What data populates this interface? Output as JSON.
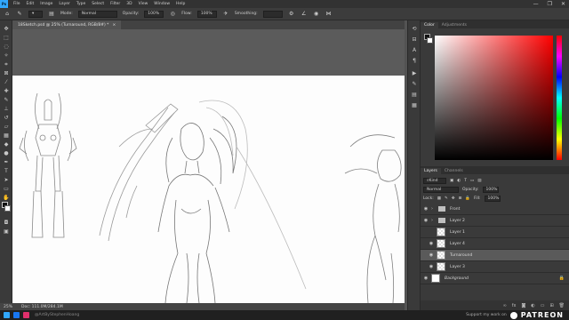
{
  "app": {
    "logo": "Ps"
  },
  "menu": [
    "File",
    "Edit",
    "Image",
    "Layer",
    "Type",
    "Select",
    "Filter",
    "3D",
    "View",
    "Window",
    "Help"
  ],
  "window_controls": [
    "—",
    "❐",
    "✕"
  ],
  "options_bar": {
    "mode_label": "Mode:",
    "mode_value": "Normal",
    "opacity_label": "Opacity:",
    "opacity_value": "100%",
    "flow_label": "Flow:",
    "flow_value": "100%",
    "smoothing_label": "Smoothing:"
  },
  "document_tab": {
    "title": "18Sketch.psd @ 25% (Turnaround, RGB/8#) *",
    "close": "×"
  },
  "color_panel": {
    "tabs": [
      "Color",
      "Adjustments"
    ],
    "accent": "#ff0000"
  },
  "layers_panel": {
    "tabs": [
      "Layers",
      "Channels"
    ],
    "kind_label": "Kind",
    "blend_mode": "Normal",
    "opacity_label": "Opacity:",
    "opacity_value": "100%",
    "lock_label": "Lock:",
    "fill_label": "Fill:",
    "fill_value": "100%",
    "layers": [
      {
        "name": "Front",
        "type": "group"
      },
      {
        "name": "Layer 2",
        "type": "group"
      },
      {
        "name": "Layer 1",
        "type": "layer"
      },
      {
        "name": "Layer 4",
        "type": "layer"
      },
      {
        "name": "Turnaround",
        "type": "layer",
        "selected": true
      },
      {
        "name": "Layer 3",
        "type": "layer"
      },
      {
        "name": "Background",
        "type": "background"
      }
    ]
  },
  "status_bar": {
    "zoom": "25%",
    "doc": "Doc: 111.0M/284.1M"
  },
  "taskbar": {
    "handle": "@ArtByStephenHoang",
    "support_text": "Support my work on",
    "brand": "PATREON"
  }
}
